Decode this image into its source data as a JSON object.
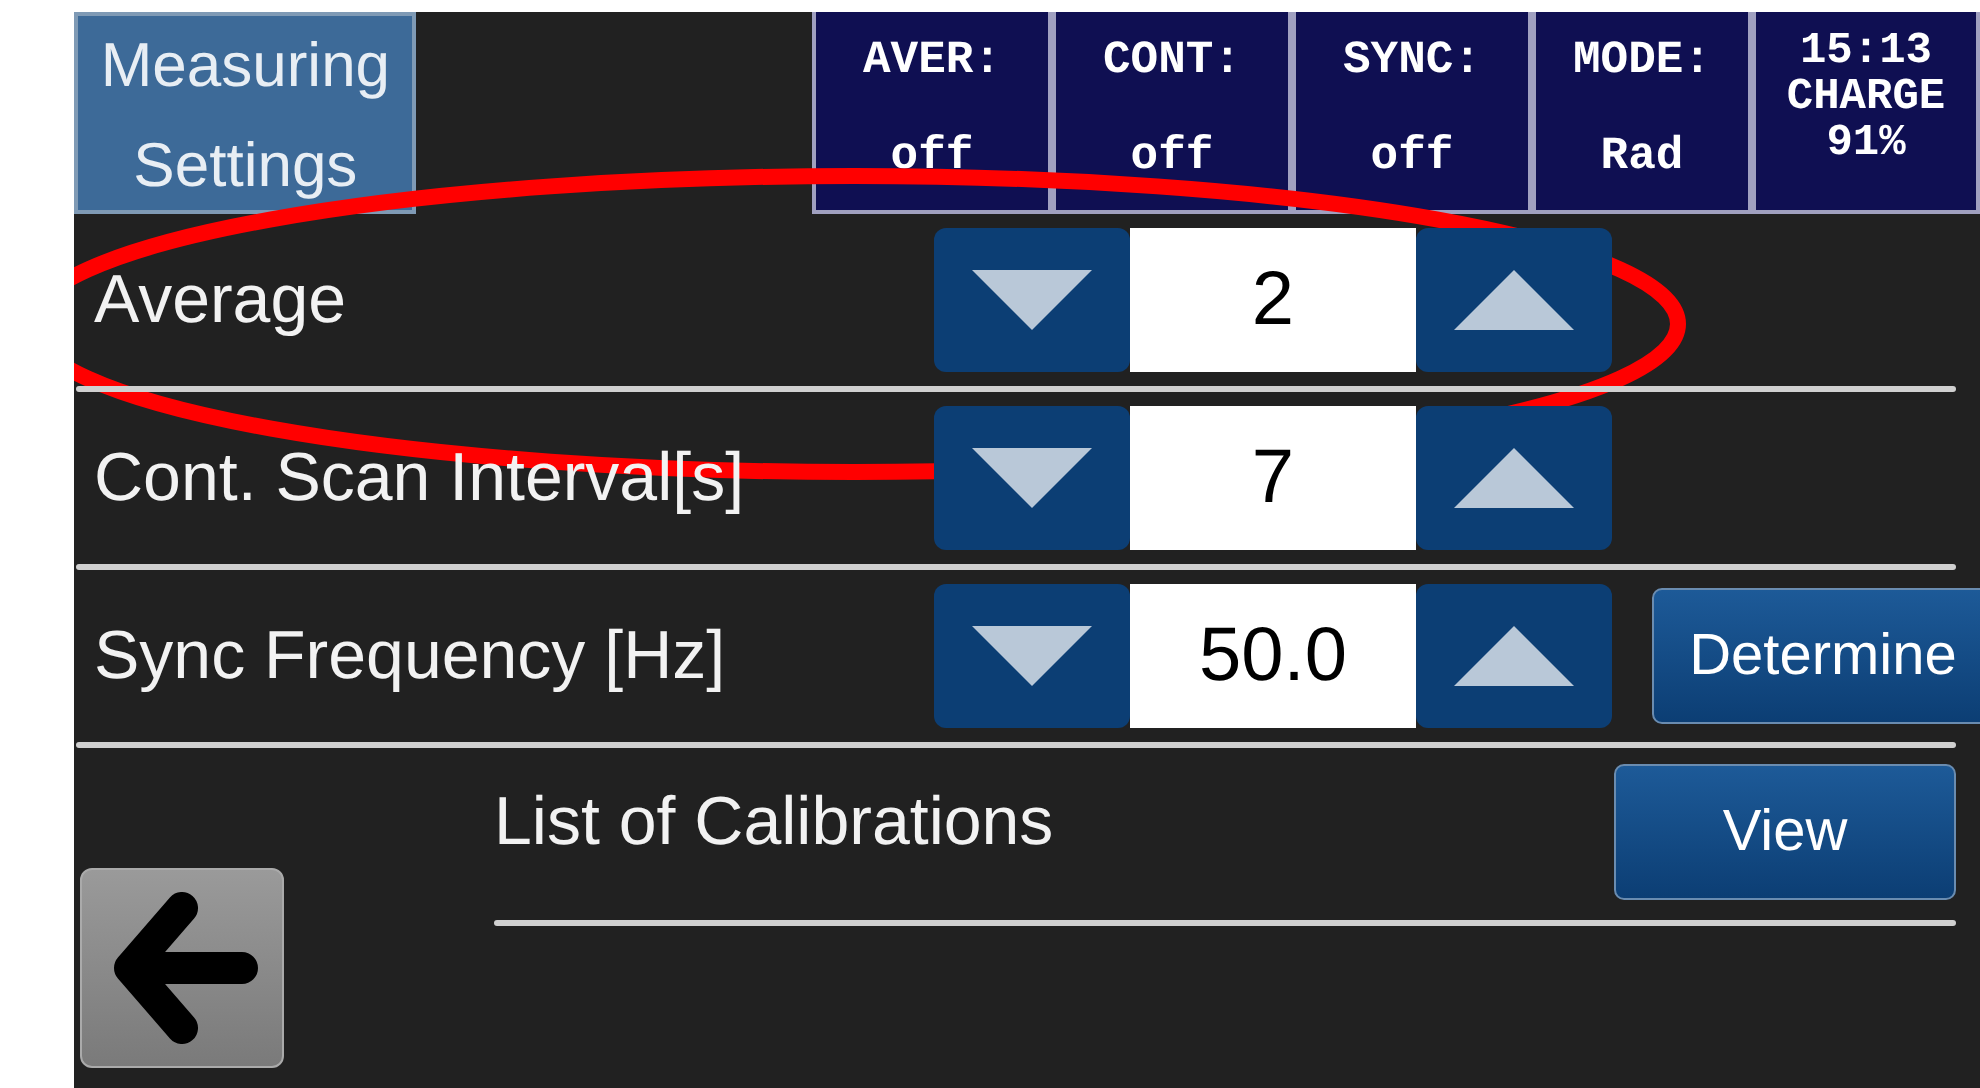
{
  "header": {
    "menu_button": [
      "Measuring",
      "Settings"
    ],
    "status": [
      {
        "lines": [
          "AVER:",
          "off"
        ]
      },
      {
        "lines": [
          "CONT:",
          "off"
        ]
      },
      {
        "lines": [
          "SYNC:",
          "off"
        ]
      },
      {
        "lines": [
          "MODE:",
          "Rad"
        ]
      },
      {
        "lines": [
          "15:13",
          "CHARGE",
          "91%"
        ]
      }
    ]
  },
  "settings": [
    {
      "kind": "spinner",
      "label": "Average",
      "value": "2"
    },
    {
      "kind": "spinner",
      "label": "Cont. Scan Interval[s]",
      "value": "7"
    },
    {
      "kind": "spinner",
      "label": "Sync Frequency [Hz]",
      "value": "50.0",
      "action": "Determine"
    },
    {
      "kind": "link",
      "label": "List of Calibrations",
      "action": "View"
    }
  ]
}
